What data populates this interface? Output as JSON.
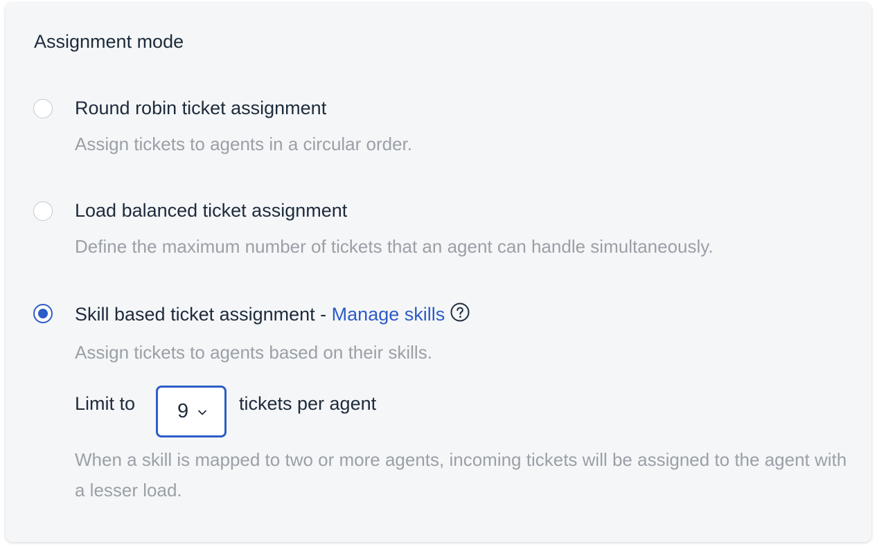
{
  "section": {
    "title": "Assignment mode"
  },
  "options": [
    {
      "label": "Round robin ticket assignment",
      "description": "Assign tickets to agents in a circular order.",
      "selected": false
    },
    {
      "label": "Load balanced ticket assignment",
      "description": "Define the maximum number of tickets that an agent can handle simultaneously.",
      "selected": false
    },
    {
      "label": "Skill based ticket assignment - ",
      "link_label": "Manage skills",
      "description": "Assign tickets to agents based on their skills.",
      "selected": true
    }
  ],
  "limit": {
    "prefix": "Limit to",
    "value": "9",
    "suffix": "tickets per agent",
    "note": "When a skill is mapped to two or more agents, incoming tickets will be assigned to the agent with a lesser load."
  },
  "icons": {
    "help": "question-circle-icon",
    "dropdown": "chevron-down-icon"
  },
  "colors": {
    "accent": "#2c5cc5",
    "text": "#1d2b3a",
    "muted": "#9aa0a6",
    "card_bg": "#f5f6f8"
  }
}
